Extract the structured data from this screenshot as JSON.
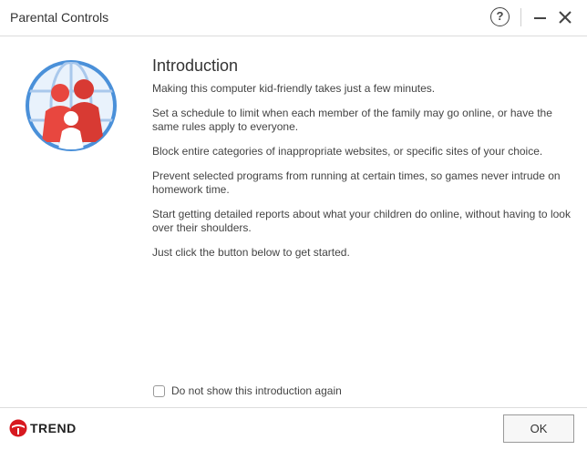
{
  "window": {
    "title": "Parental Controls",
    "help_label": "?"
  },
  "intro": {
    "heading": "Introduction",
    "paragraphs": [
      "Making this computer kid-friendly takes just a few minutes.",
      "Set a schedule to limit when each member of the family may go online, or have the same rules apply to everyone.",
      "Block entire categories of inappropriate websites, or specific sites of your choice.",
      "Prevent selected programs from running at certain times, so games never intrude on homework time.",
      "Start getting detailed reports about what your children do online, without having to look over their shoulders.",
      "Just click the button below to get started."
    ]
  },
  "footer": {
    "checkbox_label": "Do not show this introduction again",
    "checkbox_checked": false,
    "brand_name": "TREND",
    "ok_label": "OK"
  },
  "icons": {
    "logo": "family-globe-icon",
    "help": "question-circle-icon",
    "minimize": "minimize-icon",
    "close": "close-icon",
    "brand": "trend-micro-logo-icon"
  },
  "colors": {
    "brand_red": "#d71920",
    "globe_blue": "#4a90d9",
    "family_red": "#e8473f"
  }
}
